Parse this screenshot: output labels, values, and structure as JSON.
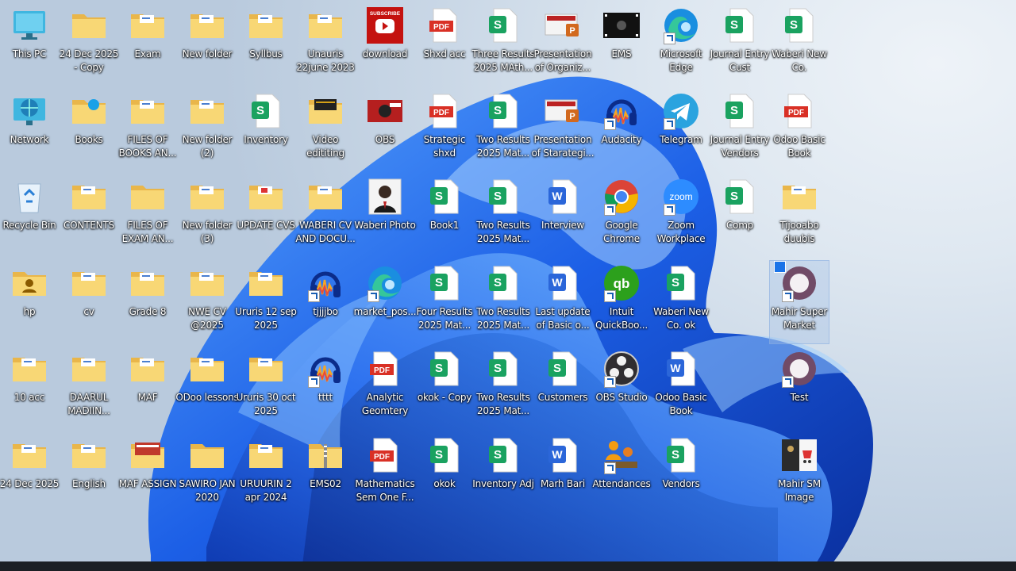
{
  "desktop": {
    "icons": [
      {
        "label": "This PC",
        "type": "pc"
      },
      {
        "label": "24 Dec 2025 - Copy",
        "type": "folder"
      },
      {
        "label": "Exam",
        "type": "folder-doc"
      },
      {
        "label": "New folder",
        "type": "folder-doc"
      },
      {
        "label": "Syllbus",
        "type": "folder-doc"
      },
      {
        "label": "Unauris 22june 2023",
        "type": "folder-doc"
      },
      {
        "label": "download",
        "type": "youtube"
      },
      {
        "label": "Shxd acc",
        "type": "pdf"
      },
      {
        "label": "Three Results 2025 MAth...",
        "type": "sheet"
      },
      {
        "label": "Presentation of Organiz...",
        "type": "ppt"
      },
      {
        "label": "EMS",
        "type": "video"
      },
      {
        "label": "Microsoft Edge",
        "type": "edge"
      },
      {
        "label": "Journal Entry Cust",
        "type": "sheet"
      },
      {
        "label": "Waberi New Co.",
        "type": "sheet"
      },
      {
        "label": "Network",
        "type": "network"
      },
      {
        "label": "Books",
        "type": "folder-edge"
      },
      {
        "label": "FILES OF BOOKS AN...",
        "type": "folder-doc"
      },
      {
        "label": "New folder (2)",
        "type": "folder-doc"
      },
      {
        "label": "Inventory",
        "type": "sheet"
      },
      {
        "label": "Video edititing",
        "type": "folder-dark"
      },
      {
        "label": "OBS",
        "type": "image"
      },
      {
        "label": "Strategic shxd",
        "type": "pdf"
      },
      {
        "label": "Two Results 2025 Mat...",
        "type": "sheet"
      },
      {
        "label": "Presentation of Starategi...",
        "type": "ppt"
      },
      {
        "label": "Audacity",
        "type": "audacity"
      },
      {
        "label": "Telegram",
        "type": "telegram"
      },
      {
        "label": "Journal Entry Vendors",
        "type": "sheet"
      },
      {
        "label": "Odoo Basic Book",
        "type": "pdf"
      },
      {
        "label": "Recycle Bin",
        "type": "recycle"
      },
      {
        "label": "CONTENTS",
        "type": "folder-doc"
      },
      {
        "label": "FILES OF EXAM AN...",
        "type": "folder"
      },
      {
        "label": "New folder (3)",
        "type": "folder-doc"
      },
      {
        "label": "UPDATE CVS",
        "type": "folder-red"
      },
      {
        "label": "WABERI CV AND DOCU...",
        "type": "folder-doc"
      },
      {
        "label": "Waberi Photo",
        "type": "photo"
      },
      {
        "label": "Book1",
        "type": "sheet"
      },
      {
        "label": "Two Results 2025 Mat...",
        "type": "sheet"
      },
      {
        "label": "Interview",
        "type": "word"
      },
      {
        "label": "Google Chrome",
        "type": "chrome"
      },
      {
        "label": "Zoom Workplace",
        "type": "zoom"
      },
      {
        "label": "Comp",
        "type": "sheet"
      },
      {
        "label": "Tijooabo duubis",
        "type": "folder-doc"
      },
      {
        "label": "hp",
        "type": "folder-user"
      },
      {
        "label": "cv",
        "type": "folder-doc"
      },
      {
        "label": "Grade 8",
        "type": "folder-doc"
      },
      {
        "label": "NWE CV @2025",
        "type": "folder-doc"
      },
      {
        "label": "Ururis 12 sep 2025",
        "type": "folder-doc"
      },
      {
        "label": "tjjjjbo",
        "type": "audacity"
      },
      {
        "label": "market_pos...",
        "type": "edge"
      },
      {
        "label": "Four Results 2025 Mat...",
        "type": "sheet"
      },
      {
        "label": "Two Results 2025 Mat...",
        "type": "sheet"
      },
      {
        "label": "Last update of Basic o...",
        "type": "word"
      },
      {
        "label": "Intuit QuickBoo...",
        "type": "qb"
      },
      {
        "label": "Waberi New Co. ok",
        "type": "sheet"
      },
      {
        "label": "Mahir Super Market",
        "type": "odoo"
      },
      {
        "label": "10 acc",
        "type": "folder-doc"
      },
      {
        "label": "DAARUL MADIIN...",
        "type": "folder-doc"
      },
      {
        "label": "MAF",
        "type": "folder-doc"
      },
      {
        "label": "ODoo lessons",
        "type": "folder-doc"
      },
      {
        "label": "Ururis 30 oct 2025",
        "type": "folder-doc"
      },
      {
        "label": "tttt",
        "type": "audacity"
      },
      {
        "label": "Analytic Geomtery",
        "type": "pdf"
      },
      {
        "label": "okok - Copy",
        "type": "sheet"
      },
      {
        "label": "Two Results 2025 Mat...",
        "type": "sheet"
      },
      {
        "label": "Customers",
        "type": "sheet"
      },
      {
        "label": "OBS Studio",
        "type": "obs"
      },
      {
        "label": "Odoo Basic Book",
        "type": "word"
      },
      {
        "label": "Test",
        "type": "odoo"
      },
      {
        "label": "24 Dec 2025",
        "type": "folder-doc"
      },
      {
        "label": "English",
        "type": "folder-doc"
      },
      {
        "label": "MAF ASSIGN",
        "type": "folder-ppt"
      },
      {
        "label": "SAWIRO JAN 2020",
        "type": "folder"
      },
      {
        "label": "URUURIN 2 apr 2024",
        "type": "folder-doc"
      },
      {
        "label": "EMS02",
        "type": "zip"
      },
      {
        "label": "Mathematics Sem One F...",
        "type": "pdf"
      },
      {
        "label": "okok",
        "type": "sheet"
      },
      {
        "label": "Inventory Adj",
        "type": "sheet"
      },
      {
        "label": "Marh Bari",
        "type": "word"
      },
      {
        "label": "Attendances",
        "type": "attend"
      },
      {
        "label": "Vendors",
        "type": "sheet"
      },
      {
        "label": "Mahir SM Image",
        "type": "mahirimg"
      }
    ],
    "text": {
      "subscribe": "SUBSCRIBE",
      "pdf": "PDF",
      "sheet": "S",
      "word": "W",
      "ppt": "P",
      "zoom": "zoom",
      "qb": "qb"
    }
  }
}
